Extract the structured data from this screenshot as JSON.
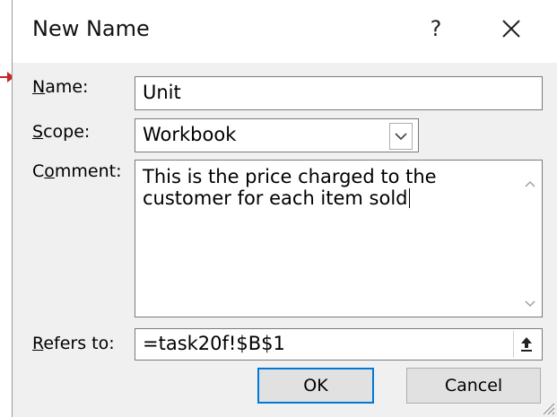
{
  "dialog": {
    "title": "New Name",
    "help_glyph": "?",
    "name": {
      "label_prefix": "",
      "label_mnemonic": "N",
      "label_rest": "ame:",
      "value": "Unit"
    },
    "scope": {
      "label_mnemonic": "S",
      "label_rest": "cope:",
      "selected": "Workbook"
    },
    "comment": {
      "label_prefix": "C",
      "label_mnemonic": "o",
      "label_rest": "mment:",
      "line1": "This is the price charged to the",
      "line2": "customer for each item sold"
    },
    "refers_to": {
      "label_mnemonic": "R",
      "label_rest": "efers to:",
      "value": "=task20f!$B$1"
    },
    "buttons": {
      "ok": "OK",
      "cancel": "Cancel"
    }
  },
  "icons": {
    "close": "close-icon",
    "dropdown": "chevron-down-icon",
    "scroll_up": "scroll-up-arrow-icon",
    "scroll_down": "scroll-down-arrow-icon",
    "collapse": "collapse-dialog-icon",
    "callout": "arrow-pointer-icon"
  },
  "colors": {
    "accent": "#0078d7",
    "dialog_bg": "#f0f0f0",
    "callout": "#c62828"
  }
}
